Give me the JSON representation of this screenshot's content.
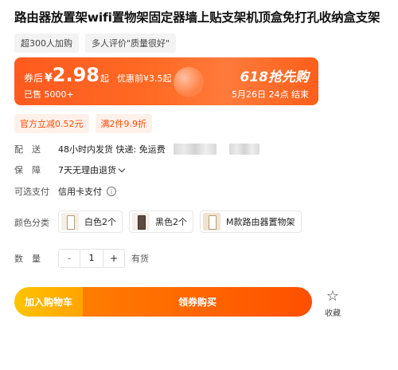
{
  "product": {
    "title": "路由器放置架wifi置物架固定器墙上贴支架机顶盒免打孔收纳盒支架",
    "tags": [
      "超300人加购",
      "多人评价\"质量很好\""
    ]
  },
  "promo": {
    "after_coupon_label": "券后",
    "currency": "¥",
    "price": "2.98",
    "price_unit": "起",
    "original_price": "优惠前¥3.5起",
    "sold": "已售 5000+",
    "event_name": "618抢先购",
    "event_time": "5月26日 24点  结束"
  },
  "coupons": [
    "官方立减0.52元",
    "满2件9.9折"
  ],
  "delivery": {
    "label": "配　送",
    "text": "48小时内发货  快递: 免运费"
  },
  "guarantee": {
    "label": "保　障",
    "text": "7天无理由退货"
  },
  "payment": {
    "label": "可选支付",
    "text": "信用卡支付",
    "info_icon": "i"
  },
  "color": {
    "label": "颜色分类",
    "options": [
      "白色2个",
      "黑色2个",
      "M款路由器置物架"
    ]
  },
  "quantity": {
    "label": "数　量",
    "minus": "-",
    "value": "1",
    "plus": "+",
    "stock": "有货"
  },
  "actions": {
    "add_to_cart": "加入购物车",
    "buy_with_coupon": "领券购买",
    "favorite": "收藏",
    "favorite_icon": "☆"
  },
  "colors": {
    "accent": "#ff5a1f",
    "cart_yellow": "#ffb300",
    "coupon_bg": "#fff1ea"
  }
}
